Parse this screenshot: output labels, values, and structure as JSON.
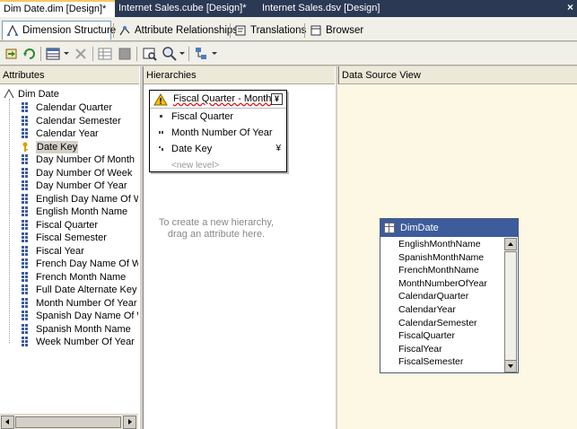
{
  "document_tabs": [
    {
      "label": "Dim Date.dim [Design]*",
      "active": true
    },
    {
      "label": "Internet Sales.cube [Design]*",
      "active": false
    },
    {
      "label": "Internet Sales.dsv [Design]",
      "active": false
    }
  ],
  "doc_close_glyph": "×",
  "designer_tabs": [
    {
      "label": "Dimension Structure",
      "icon": "dimension-structure-icon"
    },
    {
      "label": "Attribute Relationships",
      "icon": "attribute-relationships-icon"
    },
    {
      "label": "Translations",
      "icon": "translations-icon"
    },
    {
      "label": "Browser",
      "icon": "browser-icon"
    }
  ],
  "panes": {
    "attributes": "Attributes",
    "hierarchies": "Hierarchies",
    "dsv": "Data Source View"
  },
  "tree": {
    "root": "Dim Date",
    "selected": "Date Key",
    "items": [
      "Calendar Quarter",
      "Calendar Semester",
      "Calendar Year",
      "Date Key",
      "Day Number Of Month",
      "Day Number Of Week",
      "Day Number Of Year",
      "English Day Name Of Wee",
      "English Month Name",
      "Fiscal Quarter",
      "Fiscal Semester",
      "Fiscal Year",
      "French Day Name Of Wee",
      "French Month Name",
      "Full Date Alternate Key",
      "Month Number Of Year",
      "Spanish Day Name Of Wee",
      "Spanish Month Name",
      "Week Number Of Year"
    ]
  },
  "hierarchy": {
    "name": "Fiscal Quarter - Month",
    "collapse_glyph": "¥",
    "levels": [
      "Fiscal Quarter",
      "Month Number Of Year",
      "Date Key"
    ],
    "more_glyph": "¥",
    "new_level": "<new level>"
  },
  "hint": "To create a new hierarchy, drag an attribute here.",
  "table": {
    "name": "DimDate",
    "columns": [
      "EnglishMonthName",
      "SpanishMonthName",
      "FrenchMonthName",
      "MonthNumberOfYear",
      "CalendarQuarter",
      "CalendarYear",
      "CalendarSemester",
      "FiscalQuarter",
      "FiscalYear",
      "FiscalSemester"
    ]
  },
  "colors": {
    "doc_tab_bar": "#2b3954",
    "dsv_background": "#fcf8e3",
    "table_header": "#3d5c9c",
    "warning": "#f5c400"
  }
}
